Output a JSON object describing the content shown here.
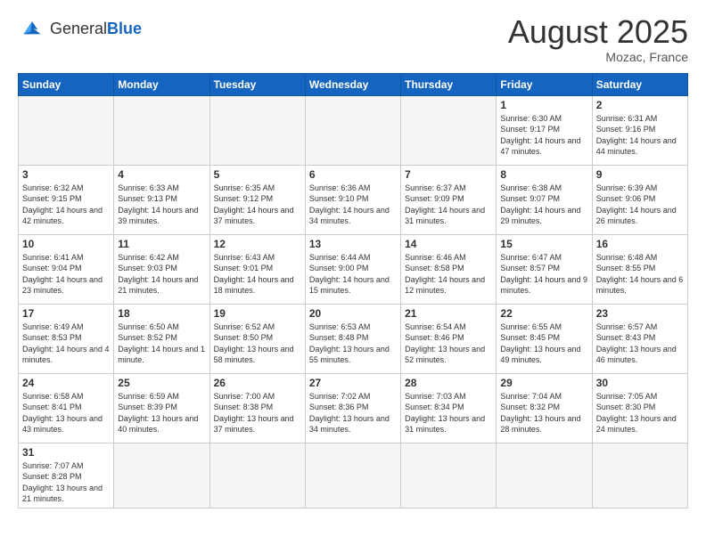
{
  "logo": {
    "general": "General",
    "blue": "Blue"
  },
  "title": {
    "month_year": "August 2025",
    "location": "Mozac, France"
  },
  "weekdays": [
    "Sunday",
    "Monday",
    "Tuesday",
    "Wednesday",
    "Thursday",
    "Friday",
    "Saturday"
  ],
  "weeks": [
    [
      {
        "day": "",
        "info": ""
      },
      {
        "day": "",
        "info": ""
      },
      {
        "day": "",
        "info": ""
      },
      {
        "day": "",
        "info": ""
      },
      {
        "day": "",
        "info": ""
      },
      {
        "day": "1",
        "info": "Sunrise: 6:30 AM\nSunset: 9:17 PM\nDaylight: 14 hours\nand 47 minutes."
      },
      {
        "day": "2",
        "info": "Sunrise: 6:31 AM\nSunset: 9:16 PM\nDaylight: 14 hours\nand 44 minutes."
      }
    ],
    [
      {
        "day": "3",
        "info": "Sunrise: 6:32 AM\nSunset: 9:15 PM\nDaylight: 14 hours\nand 42 minutes."
      },
      {
        "day": "4",
        "info": "Sunrise: 6:33 AM\nSunset: 9:13 PM\nDaylight: 14 hours\nand 39 minutes."
      },
      {
        "day": "5",
        "info": "Sunrise: 6:35 AM\nSunset: 9:12 PM\nDaylight: 14 hours\nand 37 minutes."
      },
      {
        "day": "6",
        "info": "Sunrise: 6:36 AM\nSunset: 9:10 PM\nDaylight: 14 hours\nand 34 minutes."
      },
      {
        "day": "7",
        "info": "Sunrise: 6:37 AM\nSunset: 9:09 PM\nDaylight: 14 hours\nand 31 minutes."
      },
      {
        "day": "8",
        "info": "Sunrise: 6:38 AM\nSunset: 9:07 PM\nDaylight: 14 hours\nand 29 minutes."
      },
      {
        "day": "9",
        "info": "Sunrise: 6:39 AM\nSunset: 9:06 PM\nDaylight: 14 hours\nand 26 minutes."
      }
    ],
    [
      {
        "day": "10",
        "info": "Sunrise: 6:41 AM\nSunset: 9:04 PM\nDaylight: 14 hours\nand 23 minutes."
      },
      {
        "day": "11",
        "info": "Sunrise: 6:42 AM\nSunset: 9:03 PM\nDaylight: 14 hours\nand 21 minutes."
      },
      {
        "day": "12",
        "info": "Sunrise: 6:43 AM\nSunset: 9:01 PM\nDaylight: 14 hours\nand 18 minutes."
      },
      {
        "day": "13",
        "info": "Sunrise: 6:44 AM\nSunset: 9:00 PM\nDaylight: 14 hours\nand 15 minutes."
      },
      {
        "day": "14",
        "info": "Sunrise: 6:46 AM\nSunset: 8:58 PM\nDaylight: 14 hours\nand 12 minutes."
      },
      {
        "day": "15",
        "info": "Sunrise: 6:47 AM\nSunset: 8:57 PM\nDaylight: 14 hours\nand 9 minutes."
      },
      {
        "day": "16",
        "info": "Sunrise: 6:48 AM\nSunset: 8:55 PM\nDaylight: 14 hours\nand 6 minutes."
      }
    ],
    [
      {
        "day": "17",
        "info": "Sunrise: 6:49 AM\nSunset: 8:53 PM\nDaylight: 14 hours\nand 4 minutes."
      },
      {
        "day": "18",
        "info": "Sunrise: 6:50 AM\nSunset: 8:52 PM\nDaylight: 14 hours\nand 1 minute."
      },
      {
        "day": "19",
        "info": "Sunrise: 6:52 AM\nSunset: 8:50 PM\nDaylight: 13 hours\nand 58 minutes."
      },
      {
        "day": "20",
        "info": "Sunrise: 6:53 AM\nSunset: 8:48 PM\nDaylight: 13 hours\nand 55 minutes."
      },
      {
        "day": "21",
        "info": "Sunrise: 6:54 AM\nSunset: 8:46 PM\nDaylight: 13 hours\nand 52 minutes."
      },
      {
        "day": "22",
        "info": "Sunrise: 6:55 AM\nSunset: 8:45 PM\nDaylight: 13 hours\nand 49 minutes."
      },
      {
        "day": "23",
        "info": "Sunrise: 6:57 AM\nSunset: 8:43 PM\nDaylight: 13 hours\nand 46 minutes."
      }
    ],
    [
      {
        "day": "24",
        "info": "Sunrise: 6:58 AM\nSunset: 8:41 PM\nDaylight: 13 hours\nand 43 minutes."
      },
      {
        "day": "25",
        "info": "Sunrise: 6:59 AM\nSunset: 8:39 PM\nDaylight: 13 hours\nand 40 minutes."
      },
      {
        "day": "26",
        "info": "Sunrise: 7:00 AM\nSunset: 8:38 PM\nDaylight: 13 hours\nand 37 minutes."
      },
      {
        "day": "27",
        "info": "Sunrise: 7:02 AM\nSunset: 8:36 PM\nDaylight: 13 hours\nand 34 minutes."
      },
      {
        "day": "28",
        "info": "Sunrise: 7:03 AM\nSunset: 8:34 PM\nDaylight: 13 hours\nand 31 minutes."
      },
      {
        "day": "29",
        "info": "Sunrise: 7:04 AM\nSunset: 8:32 PM\nDaylight: 13 hours\nand 28 minutes."
      },
      {
        "day": "30",
        "info": "Sunrise: 7:05 AM\nSunset: 8:30 PM\nDaylight: 13 hours\nand 24 minutes."
      }
    ],
    [
      {
        "day": "31",
        "info": "Sunrise: 7:07 AM\nSunset: 8:28 PM\nDaylight: 13 hours\nand 21 minutes."
      },
      {
        "day": "",
        "info": ""
      },
      {
        "day": "",
        "info": ""
      },
      {
        "day": "",
        "info": ""
      },
      {
        "day": "",
        "info": ""
      },
      {
        "day": "",
        "info": ""
      },
      {
        "day": "",
        "info": ""
      }
    ]
  ]
}
